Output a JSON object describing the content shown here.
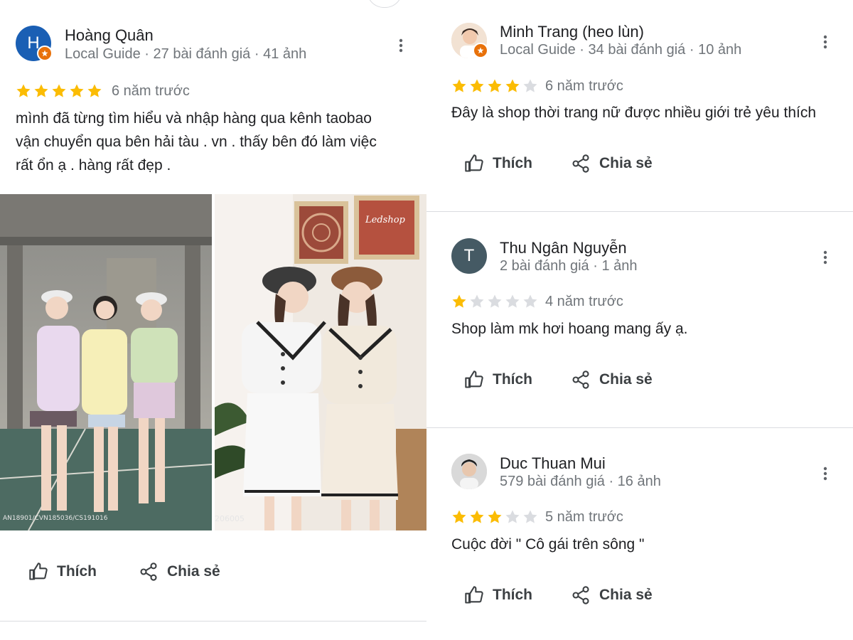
{
  "colors": {
    "star_filled": "#fbbc04",
    "star_empty": "#dadce0",
    "local_guide_badge": "#e8710a",
    "avatar_h": "#1a5fb4",
    "avatar_t": "#455a64"
  },
  "actions": {
    "like_label": "Thích",
    "share_label": "Chia sẻ"
  },
  "reviews": [
    {
      "name": "Hoàng Quân",
      "avatar_letter": "H",
      "meta": "Local Guide · 27 bài đánh giá · 41 ảnh",
      "rating": 5,
      "when": "6 năm trước",
      "text_lines": [
        "mình đã từng tìm hiểu và nhập hàng qua kênh taobao",
        "vận chuyển qua bên hải tàu . vn . thấy bên đó làm việc",
        "rất ổn ạ . hàng rất đẹp ."
      ],
      "photo_captions": [
        "AN18901/CVN185036/CS191016",
        "206005"
      ],
      "photo_watermark": "Ledshop"
    },
    {
      "name": "Minh Trang (heo lùn)",
      "meta": "Local Guide · 34 bài đánh giá · 10 ảnh",
      "rating": 4,
      "when": "6 năm trước",
      "text": "Đây là shop thời trang nữ được nhiều giới trẻ yêu thích"
    },
    {
      "name": "Thu Ngân Nguyễn",
      "avatar_letter": "T",
      "meta": "2 bài đánh giá · 1 ảnh",
      "rating": 1,
      "when": "4 năm trước",
      "text": "Shop làm mk hơi hoang mang ấy ạ."
    },
    {
      "name": "Duc Thuan Mui",
      "meta": "579 bài đánh giá · 16 ảnh",
      "rating": 3,
      "when": "5 năm trước",
      "text": "Cuộc đời \" Cô gái trên sông \""
    }
  ]
}
